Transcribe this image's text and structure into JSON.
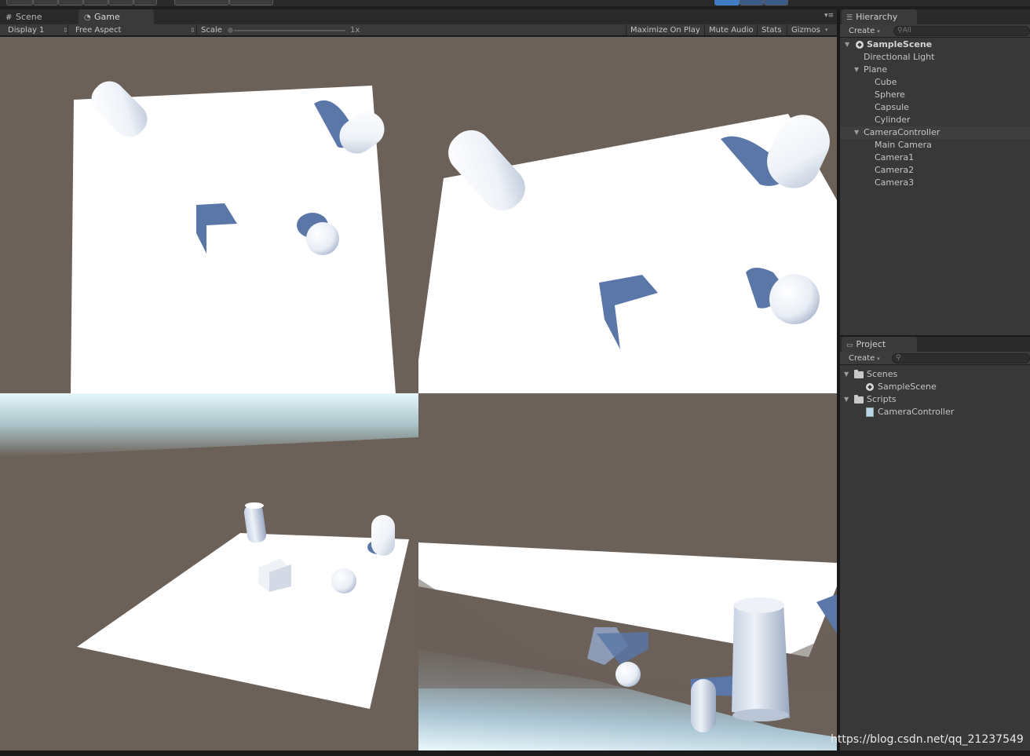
{
  "game_view": {
    "tabs": [
      {
        "label": "Scene",
        "icon": "grid-icon"
      },
      {
        "label": "Game",
        "icon": "pacman-icon"
      }
    ],
    "toolbar": {
      "display": "Display 1",
      "aspect": "Free Aspect",
      "scale_label": "Scale",
      "scale_value": "1x",
      "maximize": "Maximize On Play",
      "mute": "Mute Audio",
      "stats": "Stats",
      "gizmos": "Gizmos"
    }
  },
  "hierarchy": {
    "tab": "Hierarchy",
    "create": "Create",
    "search_placeholder": "All",
    "items": [
      {
        "label": "SampleScene",
        "depth": 0,
        "expanded": true,
        "scene": true
      },
      {
        "label": "Directional Light",
        "depth": 1
      },
      {
        "label": "Plane",
        "depth": 1,
        "expanded": true
      },
      {
        "label": "Cube",
        "depth": 2
      },
      {
        "label": "Sphere",
        "depth": 2
      },
      {
        "label": "Capsule",
        "depth": 2
      },
      {
        "label": "Cylinder",
        "depth": 2
      },
      {
        "label": "CameraController",
        "depth": 1,
        "expanded": true,
        "selected": true
      },
      {
        "label": "Main Camera",
        "depth": 2
      },
      {
        "label": "Camera1",
        "depth": 2
      },
      {
        "label": "Camera2",
        "depth": 2
      },
      {
        "label": "Camera3",
        "depth": 2
      }
    ]
  },
  "project": {
    "tab": "Project",
    "create": "Create",
    "items": [
      {
        "label": "Scenes",
        "type": "folder"
      },
      {
        "label": "SampleScene",
        "type": "scene"
      },
      {
        "label": "Scripts",
        "type": "folder"
      },
      {
        "label": "CameraController",
        "type": "script"
      }
    ]
  },
  "watermark": "https://blog.csdn.net/qq_21237549"
}
